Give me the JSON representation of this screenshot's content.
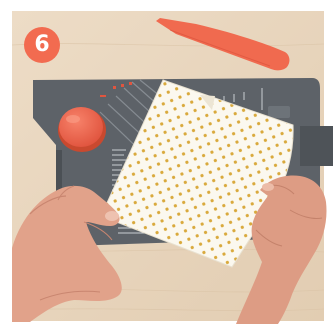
{
  "step": {
    "number": "6",
    "badge_color": "#f26b50"
  },
  "colors": {
    "table": "#ead8c2",
    "board": "#5d6268",
    "knob": "#f0654e",
    "folder": "#f06a4f",
    "paper": "#fbf8ef",
    "dots": "#d9a93c",
    "skin": "#e0a088"
  },
  "objects": [
    "wood-tabletop",
    "envelope-punch-board",
    "scoring-tool",
    "polka-dot-paper",
    "left-hand",
    "right-hand"
  ]
}
